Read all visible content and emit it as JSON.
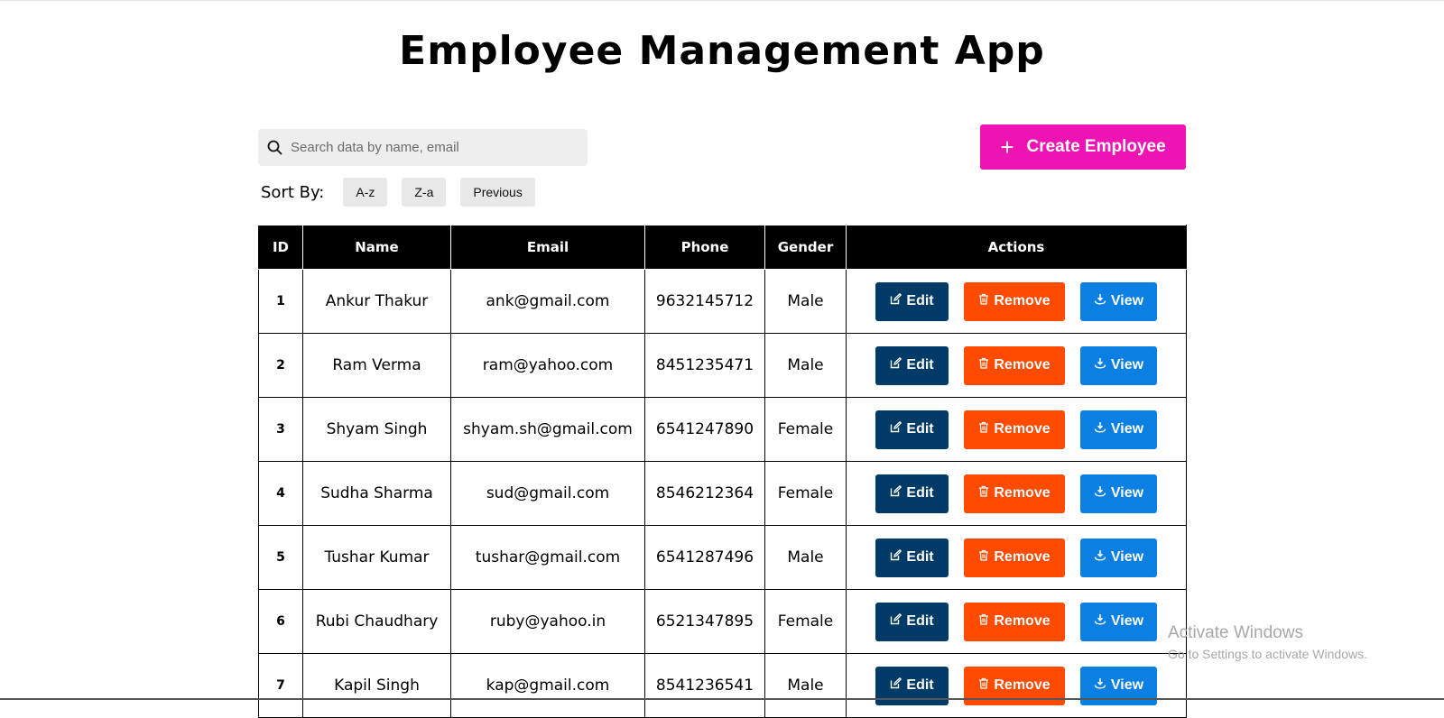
{
  "app": {
    "title": "Employee Management App"
  },
  "search": {
    "placeholder": "Search data by name, email",
    "value": ""
  },
  "create_button": {
    "label": "Create Employee"
  },
  "sort": {
    "label": "Sort By:",
    "options": [
      "A-z",
      "Z-a",
      "Previous"
    ]
  },
  "table": {
    "headers": [
      "ID",
      "Name",
      "Email",
      "Phone",
      "Gender",
      "Actions"
    ],
    "rows": [
      {
        "id": "1",
        "name": "Ankur Thakur",
        "email": "ank@gmail.com",
        "phone": "9632145712",
        "gender": "Male"
      },
      {
        "id": "2",
        "name": "Ram Verma",
        "email": "ram@yahoo.com",
        "phone": "8451235471",
        "gender": "Male"
      },
      {
        "id": "3",
        "name": "Shyam Singh",
        "email": "shyam.sh@gmail.com",
        "phone": "6541247890",
        "gender": "Female"
      },
      {
        "id": "4",
        "name": "Sudha Sharma",
        "email": "sud@gmail.com",
        "phone": "8546212364",
        "gender": "Female"
      },
      {
        "id": "5",
        "name": "Tushar Kumar",
        "email": "tushar@gmail.com",
        "phone": "6541287496",
        "gender": "Male"
      },
      {
        "id": "6",
        "name": "Rubi Chaudhary",
        "email": "ruby@yahoo.in",
        "phone": "6521347895",
        "gender": "Female"
      },
      {
        "id": "7",
        "name": "Kapil Singh",
        "email": "kap@gmail.com",
        "phone": "8541236541",
        "gender": "Male"
      }
    ],
    "actions": {
      "edit": "Edit",
      "remove": "Remove",
      "view": "View"
    }
  },
  "watermark": {
    "title": "Activate Windows",
    "subtitle": "Go to Settings to activate Windows."
  },
  "colors": {
    "create": "#ee14b4",
    "edit": "#003a66",
    "remove": "#ff4b00",
    "view": "#0c7fe2",
    "header_bg": "#000000",
    "search_bg": "#eeeeee",
    "sort_bg": "#e8e8e8"
  },
  "icons": {
    "search": "search-icon",
    "create": "plus-icon",
    "edit": "edit-icon",
    "remove": "trash-icon",
    "view": "download-icon"
  }
}
